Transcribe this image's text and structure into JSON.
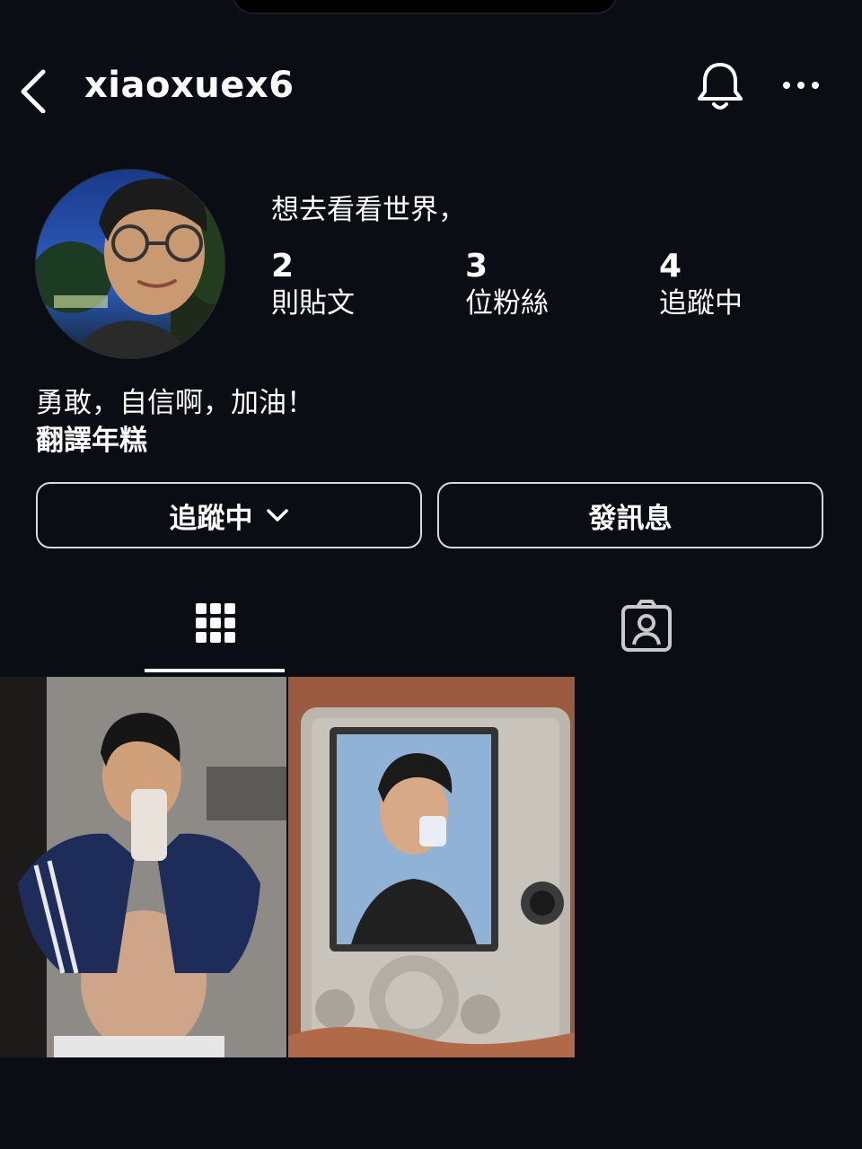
{
  "header": {
    "username": "xiaoxuex6",
    "back_icon": "chevron-left-icon",
    "notification_icon": "bell-icon",
    "more_icon": "more-horizontal-icon"
  },
  "profile": {
    "display_name": "想去看看世界，",
    "avatar_icon": "profile-avatar",
    "stats": [
      {
        "value": "2",
        "label": "則貼文"
      },
      {
        "value": "3",
        "label": "位粉絲"
      },
      {
        "value": "4",
        "label": "追蹤中"
      }
    ],
    "bio_line1": "勇敢，自信啊，加油！",
    "bio_line2": "翻譯年糕"
  },
  "actions": {
    "following_label": "追蹤中",
    "message_label": "發訊息"
  },
  "tabs": [
    {
      "name": "grid",
      "icon": "grid-icon",
      "active": true
    },
    {
      "name": "tagged",
      "icon": "tagged-person-icon",
      "active": false
    }
  ],
  "colors": {
    "background": "#0b0d14",
    "text": "#ffffff",
    "button_border": "#d8d9dd"
  }
}
